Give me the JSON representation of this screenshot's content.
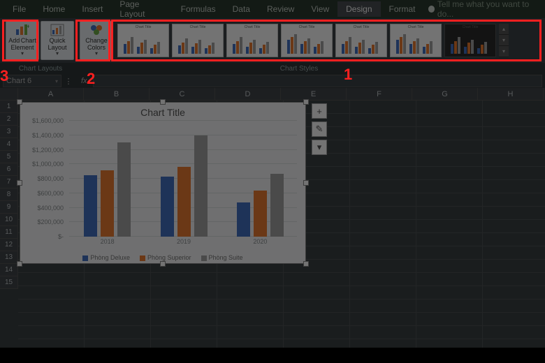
{
  "menu": {
    "items": [
      "File",
      "Home",
      "Insert",
      "Page Layout",
      "Formulas",
      "Data",
      "Review",
      "View",
      "Design",
      "Format"
    ],
    "active_index": 8,
    "tell_me": "Tell me what you want to do..."
  },
  "ribbon": {
    "add_chart_element": "Add Chart Element",
    "quick_layout": "Quick Layout",
    "change_colors": "Change Colors",
    "group_chart_layouts": "Chart Layouts",
    "group_chart_styles": "Chart Styles",
    "style_thumb_title": "Chart Title",
    "styles_count": 7
  },
  "annotations": {
    "m1": "1",
    "m2": "2",
    "m3": "3"
  },
  "formula_bar": {
    "namebox": "Chart 6",
    "fx_label": "fx",
    "value": ""
  },
  "sheet": {
    "columns": [
      "A",
      "B",
      "C",
      "D",
      "E",
      "F",
      "G",
      "H"
    ],
    "rows": [
      "1",
      "2",
      "3",
      "4",
      "5",
      "6",
      "7",
      "8",
      "9",
      "10",
      "11",
      "12",
      "13",
      "14",
      "15"
    ]
  },
  "chart_data": {
    "type": "bar",
    "title": "Chart Title",
    "categories": [
      "2018",
      "2019",
      "2020"
    ],
    "series": [
      {
        "name": "Phòng Deluxe",
        "color": "#4472c4",
        "values": [
          850000,
          830000,
          470000
        ]
      },
      {
        "name": "Phòng Superior",
        "color": "#ed7d31",
        "values": [
          920000,
          960000,
          640000
        ]
      },
      {
        "name": "Phòng Suite",
        "color": "#a5a5a5",
        "values": [
          1300000,
          1400000,
          870000
        ]
      }
    ],
    "ylabel": "",
    "xlabel": "",
    "ylim": [
      0,
      1600000
    ],
    "yticks": [
      "$-",
      "$200,000",
      "$400,000",
      "$600,000",
      "$800,000",
      "$1,000,000",
      "$1,200,000",
      "$1,400,000",
      "$1,600,000"
    ]
  },
  "flyout": {
    "plus": "+",
    "brush": "✎",
    "filter": "▾"
  }
}
